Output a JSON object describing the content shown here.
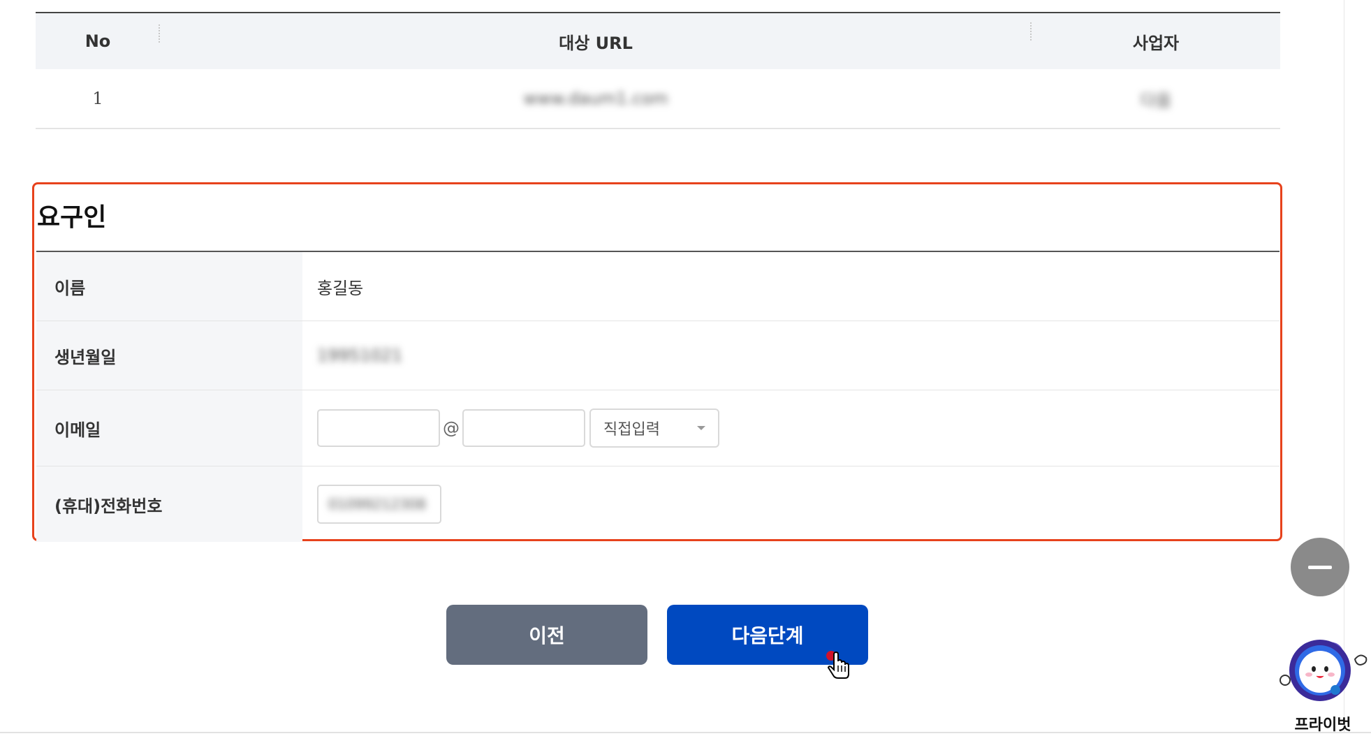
{
  "url_table": {
    "headers": {
      "no": "No",
      "url": "대상 URL",
      "business": "사업자"
    },
    "rows": [
      {
        "no": "1",
        "url": "www.daum1.com",
        "business": "다음"
      }
    ]
  },
  "requester": {
    "title": "요구인",
    "name_label": "이름",
    "name_value": "홍길동",
    "birth_label": "생년월일",
    "birth_value": "19951021",
    "email_label": "이메일",
    "email_local": "",
    "email_at": "@",
    "email_domain": "",
    "email_select": "직접입력",
    "phone_label": "(휴대)전화번호",
    "phone_value": "01099212308"
  },
  "buttons": {
    "prev": "이전",
    "next": "다음단계"
  },
  "widget": {
    "label": "프라이벗"
  },
  "colors": {
    "highlight_border": "#e7421c",
    "prev_button": "#636d7e",
    "next_button": "#0049c0"
  }
}
